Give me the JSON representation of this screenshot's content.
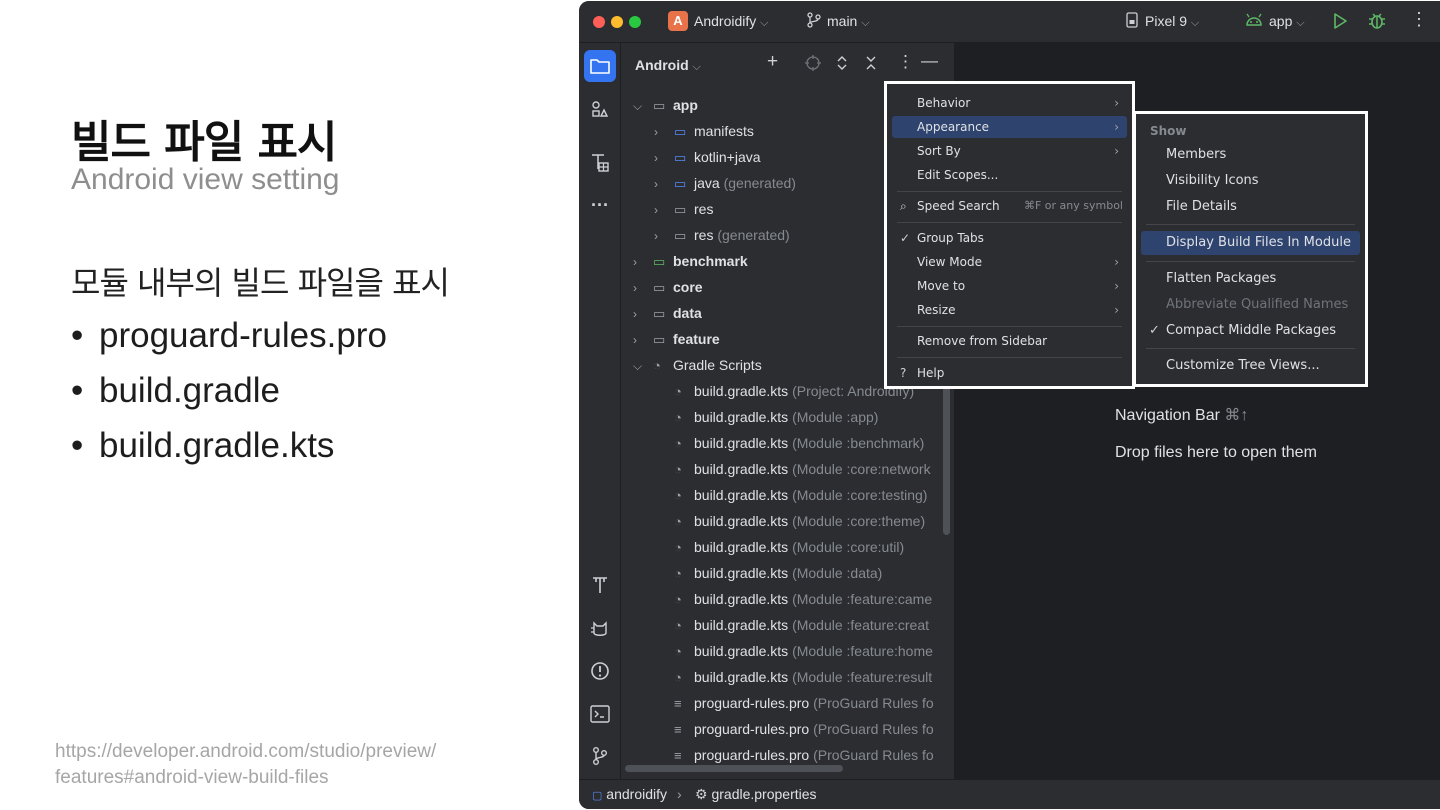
{
  "slide": {
    "title": "빌드 파일 표시",
    "subtitle": "Android view setting",
    "description": "모듈 내부의 빌드 파일을 표시",
    "bullets": [
      "proguard-rules.pro",
      "build.gradle",
      "build.gradle.kts"
    ],
    "bullet_char": "•",
    "source_line1": "https://developer.android.com/studio/preview/",
    "source_line2": "features#android-view-build-files"
  },
  "titlebar": {
    "project_letter": "A",
    "project_name": "Androidify",
    "branch": "main",
    "device": "Pixel 9",
    "run_config": "app"
  },
  "panel": {
    "title": "Android"
  },
  "tree": {
    "app": "app",
    "manifests": "manifests",
    "kotlin_java": "kotlin+java",
    "java": "java",
    "java_hint": "(generated)",
    "res": "res",
    "res_gen": "res",
    "res_gen_hint": "(generated)",
    "benchmark": "benchmark",
    "core": "core",
    "data": "data",
    "feature": "feature",
    "gradle_scripts": "Gradle Scripts",
    "gradle_files": [
      {
        "name": "build.gradle.kts",
        "hint": "(Project: Androidify)"
      },
      {
        "name": "build.gradle.kts",
        "hint": "(Module :app)"
      },
      {
        "name": "build.gradle.kts",
        "hint": "(Module :benchmark)"
      },
      {
        "name": "build.gradle.kts",
        "hint": "(Module :core:network"
      },
      {
        "name": "build.gradle.kts",
        "hint": "(Module :core:testing)"
      },
      {
        "name": "build.gradle.kts",
        "hint": "(Module :core:theme)"
      },
      {
        "name": "build.gradle.kts",
        "hint": "(Module :core:util)"
      },
      {
        "name": "build.gradle.kts",
        "hint": "(Module :data)"
      },
      {
        "name": "build.gradle.kts",
        "hint": "(Module :feature:came"
      },
      {
        "name": "build.gradle.kts",
        "hint": "(Module :feature:creat"
      },
      {
        "name": "build.gradle.kts",
        "hint": "(Module :feature:home"
      },
      {
        "name": "build.gradle.kts",
        "hint": "(Module :feature:result"
      }
    ],
    "proguard_files": [
      {
        "name": "proguard-rules.pro",
        "hint": "(ProGuard Rules fo"
      },
      {
        "name": "proguard-rules.pro",
        "hint": "(ProGuard Rules fo"
      },
      {
        "name": "proguard-rules.pro",
        "hint": "(ProGuard Rules fo"
      }
    ]
  },
  "options_menu": {
    "behavior": "Behavior",
    "appearance": "Appearance",
    "sort_by": "Sort By",
    "edit_scopes": "Edit Scopes...",
    "speed_search": "Speed Search",
    "speed_search_shortcut": "⌘F or any symbol",
    "group_tabs": "Group Tabs",
    "view_mode": "View Mode",
    "move_to": "Move to",
    "resize": "Resize",
    "remove_from_sidebar": "Remove from Sidebar",
    "help": "Help"
  },
  "appearance_menu": {
    "section_show": "Show",
    "members": "Members",
    "visibility_icons": "Visibility Icons",
    "file_details": "File Details",
    "display_build_files": "Display Build Files In Module",
    "flatten_packages": "Flatten Packages",
    "abbreviate_names": "Abbreviate Qualified Names",
    "compact_middle": "Compact Middle Packages",
    "customize_tree": "Customize Tree Views..."
  },
  "editor": {
    "nav_bar": "Navigation Bar",
    "nav_bar_shortcut": "⌘↑",
    "drop_files": "Drop files here to open them"
  },
  "statusbar": {
    "project": "androidify",
    "file": "gradle.properties"
  },
  "colors": {
    "accent": "#3574f0",
    "selection": "#2e436e",
    "ide_bg": "#1e1f22",
    "panel_bg": "#2b2d30",
    "run_green": "#5fb865"
  }
}
